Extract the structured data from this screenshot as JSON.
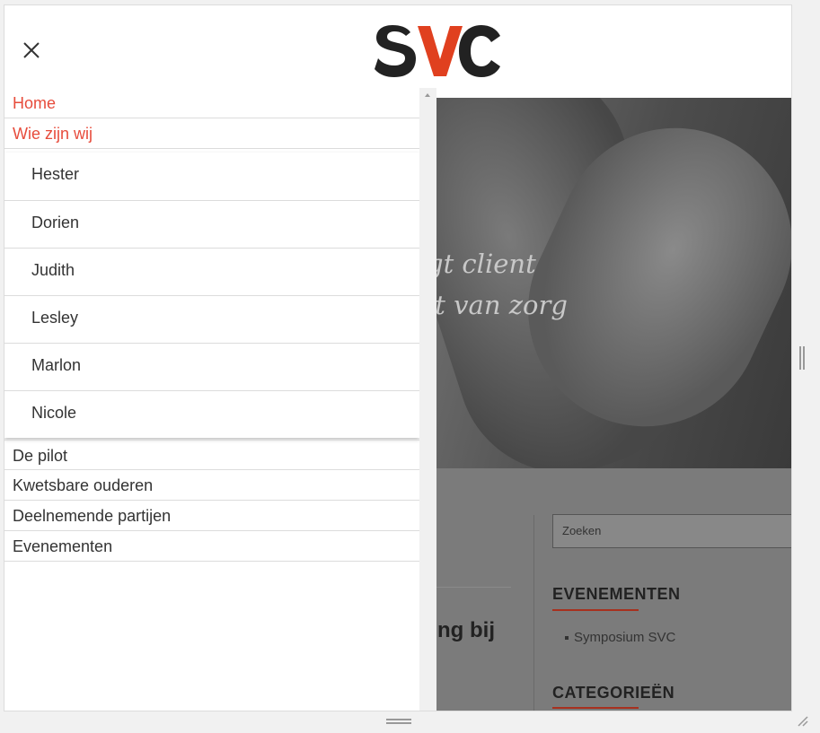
{
  "logo": {
    "text": "SVC",
    "colors": {
      "dark": "#222222",
      "accent": "#e0401f"
    }
  },
  "hero": {
    "tagline_lines": [
      "gt client",
      "it van zorg"
    ]
  },
  "content": {
    "post_title_partial": "ng bij",
    "search": {
      "placeholder": "Zoeken"
    },
    "widgets": [
      {
        "title": "EVENEMENTEN",
        "items": [
          "Symposium SVC"
        ]
      },
      {
        "title": "CATEGORIEËN"
      }
    ]
  },
  "menu": {
    "items": [
      {
        "label": "Home",
        "active": true
      },
      {
        "label": "Wie zijn wij",
        "active": true
      },
      {
        "label": "De pilot",
        "active": false
      },
      {
        "label": "Kwetsbare ouderen",
        "active": false
      },
      {
        "label": "Deelnemende partijen",
        "active": false
      },
      {
        "label": "Evenementen",
        "active": false
      }
    ],
    "submenu": [
      "Hester",
      "Dorien",
      "Judith",
      "Lesley",
      "Marlon",
      "Nicole"
    ]
  },
  "icons": {
    "close": "close-icon",
    "scroll_up": "scroll-up-arrow-icon",
    "splitter": "splitter-handle-icon",
    "resize": "resize-grip-icon"
  },
  "colors": {
    "accent": "#e74c3c",
    "widget_underline": "#a7301e",
    "overlay_bg": "#7b7b7b"
  }
}
